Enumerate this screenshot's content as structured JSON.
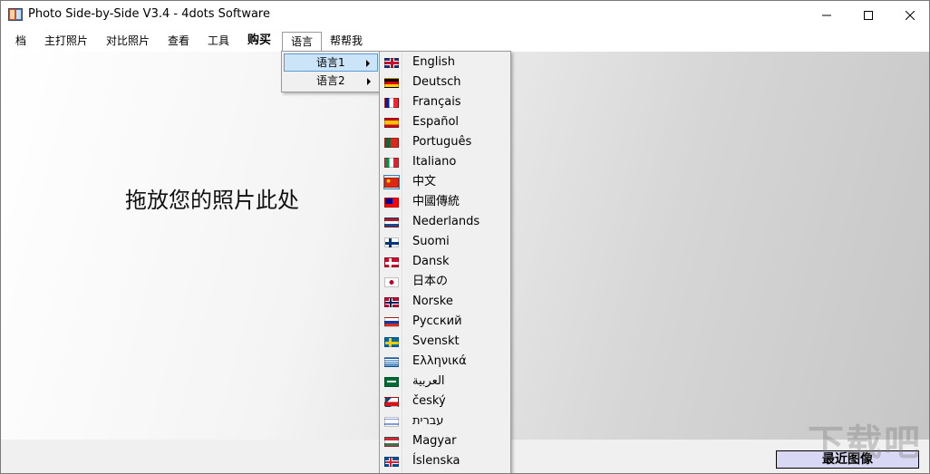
{
  "window": {
    "title": "Photo Side-by-Side V3.4 - 4dots Software"
  },
  "menubar": {
    "items": [
      {
        "label": "档"
      },
      {
        "label": "主打照片"
      },
      {
        "label": "对比照片"
      },
      {
        "label": "查看"
      },
      {
        "label": "工具"
      },
      {
        "label": "购买"
      },
      {
        "label": "语言"
      },
      {
        "label": "帮帮我"
      }
    ]
  },
  "language_submenu": {
    "items": [
      {
        "label": "语言1"
      },
      {
        "label": "语言2"
      }
    ]
  },
  "language_list": {
    "selected": "中文",
    "items": [
      {
        "label": "English",
        "flag": "uk-flag-icon"
      },
      {
        "label": "Deutsch",
        "flag": "germany-flag-icon"
      },
      {
        "label": "Français",
        "flag": "france-flag-icon"
      },
      {
        "label": "Español",
        "flag": "spain-flag-icon"
      },
      {
        "label": "Português",
        "flag": "portugal-flag-icon"
      },
      {
        "label": "Italiano",
        "flag": "italy-flag-icon"
      },
      {
        "label": "中文",
        "flag": "china-flag-icon"
      },
      {
        "label": "中國傳統",
        "flag": "taiwan-flag-icon"
      },
      {
        "label": "Nederlands",
        "flag": "netherlands-flag-icon"
      },
      {
        "label": "Suomi",
        "flag": "finland-flag-icon"
      },
      {
        "label": "Dansk",
        "flag": "denmark-flag-icon"
      },
      {
        "label": "日本の",
        "flag": "japan-flag-icon"
      },
      {
        "label": "Norske",
        "flag": "norway-flag-icon"
      },
      {
        "label": "Русский",
        "flag": "russia-flag-icon"
      },
      {
        "label": "Svenskt",
        "flag": "sweden-flag-icon"
      },
      {
        "label": "Ελληνικά",
        "flag": "greece-flag-icon"
      },
      {
        "label": "العربية",
        "flag": "saudi-flag-icon"
      },
      {
        "label": "český",
        "flag": "czech-flag-icon"
      },
      {
        "label": "עברית",
        "flag": "israel-flag-icon"
      },
      {
        "label": "Magyar",
        "flag": "hungary-flag-icon"
      },
      {
        "label": "Íslenska",
        "flag": "iceland-flag-icon"
      }
    ]
  },
  "main": {
    "drop_hint": "拖放您的照片此处"
  },
  "bottom": {
    "recent_images_label": "最近图像"
  },
  "watermark": {
    "text": "下载吧"
  }
}
